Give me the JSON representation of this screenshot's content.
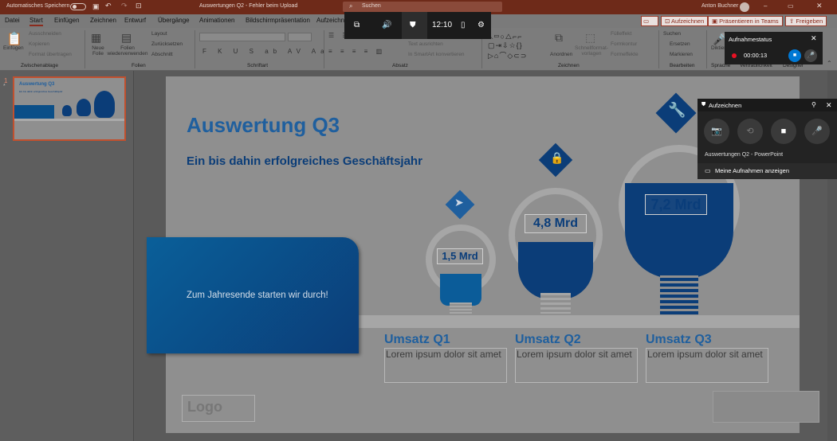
{
  "title_bar": {
    "autosave_label": "Automatisches Speichern",
    "doc_title": "Auswertungen Q2 - Fehler beim Upload",
    "search_placeholder": "Suchen",
    "user_name": "Anton Buchner"
  },
  "tabs": [
    "Datei",
    "Start",
    "Einfügen",
    "Zeichnen",
    "Entwurf",
    "Übergänge",
    "Animationen",
    "Bildschirmpräsentation",
    "Aufzeichnen"
  ],
  "top_buttons": {
    "record": "Aufzeichnen",
    "present_teams": "Präsentieren in Teams",
    "share": "Freigeben"
  },
  "ribbon": {
    "clipboard": {
      "paste": "Einfügen",
      "cut": "Ausschneiden",
      "copy": "Kopieren",
      "format": "Format übertragen",
      "label": "Zwischenablage"
    },
    "slides": {
      "new_slide": "Neue Folie",
      "reuse": "Folien wiederverwenden",
      "layout": "Layout",
      "reset": "Zurücksetzen",
      "section": "Abschnitt",
      "label": "Folien"
    },
    "font": {
      "label": "Schriftart"
    },
    "paragraph": {
      "text_dir": "Text ausrichten",
      "smartart": "In SmartArt konvertieren",
      "label": "Absatz"
    },
    "drawing": {
      "arrange": "Anordnen",
      "quick_styles": "Schnellformat-vorlagen",
      "fill": "Fülleffekt",
      "outline": "Formkontur",
      "effects": "Formeffekte",
      "label": "Zeichnen"
    },
    "editing": {
      "find": "Suchen",
      "replace": "Ersetzen",
      "select": "Markieren",
      "label": "Bearbeiten"
    },
    "voice": {
      "dictate": "Diktier",
      "label": "Sprache"
    },
    "extra_labels": [
      "Vertraulichkeit",
      "Designer"
    ]
  },
  "thumbnail": {
    "number": "1",
    "star": "*"
  },
  "slide": {
    "title": "Auswertung Q3",
    "subtitle": "Ein bis dahin erfolgreiches Geschäftsjahr",
    "banner_text": "Zum Jahresende starten wir durch!",
    "logo": "Logo",
    "bulbs": [
      {
        "value": "1,5 Mrd",
        "heading": "Umsatz Q1",
        "lorem": "Lorem ipsum dolor sit amet"
      },
      {
        "value": "4,8 Mrd",
        "heading": "Umsatz Q2",
        "lorem": "Lorem ipsum dolor sit amet"
      },
      {
        "value": "7,2 Mrd",
        "heading": "Umsatz Q3",
        "lorem": "Lorem ipsum dolor sit amet"
      }
    ]
  },
  "gamebar": {
    "time": "12:10"
  },
  "record_status": {
    "title": "Aufnahmestatus",
    "elapsed": "00:00:13"
  },
  "capture_panel": {
    "title": "Aufzeichnen",
    "target": "Auswertungen Q2 - PowerPoint",
    "show_recordings": "Meine Aufnahmen anzeigen"
  },
  "colors": {
    "accent": "#1f5f9e",
    "title_bar": "#6e2a19",
    "dark_blue": "#0b3d78",
    "record_red": "#e81123"
  }
}
